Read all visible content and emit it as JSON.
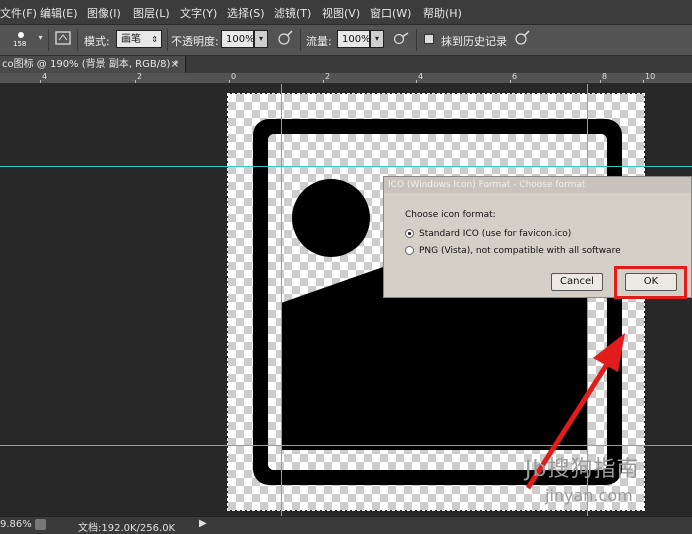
{
  "menubar": {
    "items": [
      "文件(F)",
      "编辑(E)",
      "图像(I)",
      "图层(L)",
      "文字(Y)",
      "选择(S)",
      "滤镜(T)",
      "视图(V)",
      "窗口(W)",
      "帮助(H)"
    ]
  },
  "options": {
    "brush_size": "158",
    "mode_label": "模式:",
    "mode_value": "画笔",
    "opacity_label": "不透明度:",
    "opacity_value": "100%",
    "flow_label": "流量:",
    "flow_value": "100%",
    "history_label": "抹到历史记录"
  },
  "tab": {
    "title": "co图标 @ 190% (背景 副本, RGB/8) *",
    "close": "×"
  },
  "ruler": {
    "labels": [
      "4",
      "2",
      "0",
      "2",
      "4",
      "6",
      "8",
      "10"
    ]
  },
  "status": {
    "zoom": "9.86%",
    "doc_info": "文档:192.0K/256.0K"
  },
  "dialog": {
    "title": "ICO (Windows Icon) Format - Choose format",
    "prompt": "Choose icon format:",
    "option_standard": "Standard ICO (use for favicon.ico)",
    "option_png": "PNG (Vista), not compatible with all software",
    "cancel_label": "Cancel",
    "ok_label": "OK"
  },
  "watermark": {
    "text": "Jb搜狗指南",
    "url": "jinyan.com"
  },
  "colors": {
    "accent_red": "#e21b1b",
    "guide_cyan": "#33c7c7"
  }
}
